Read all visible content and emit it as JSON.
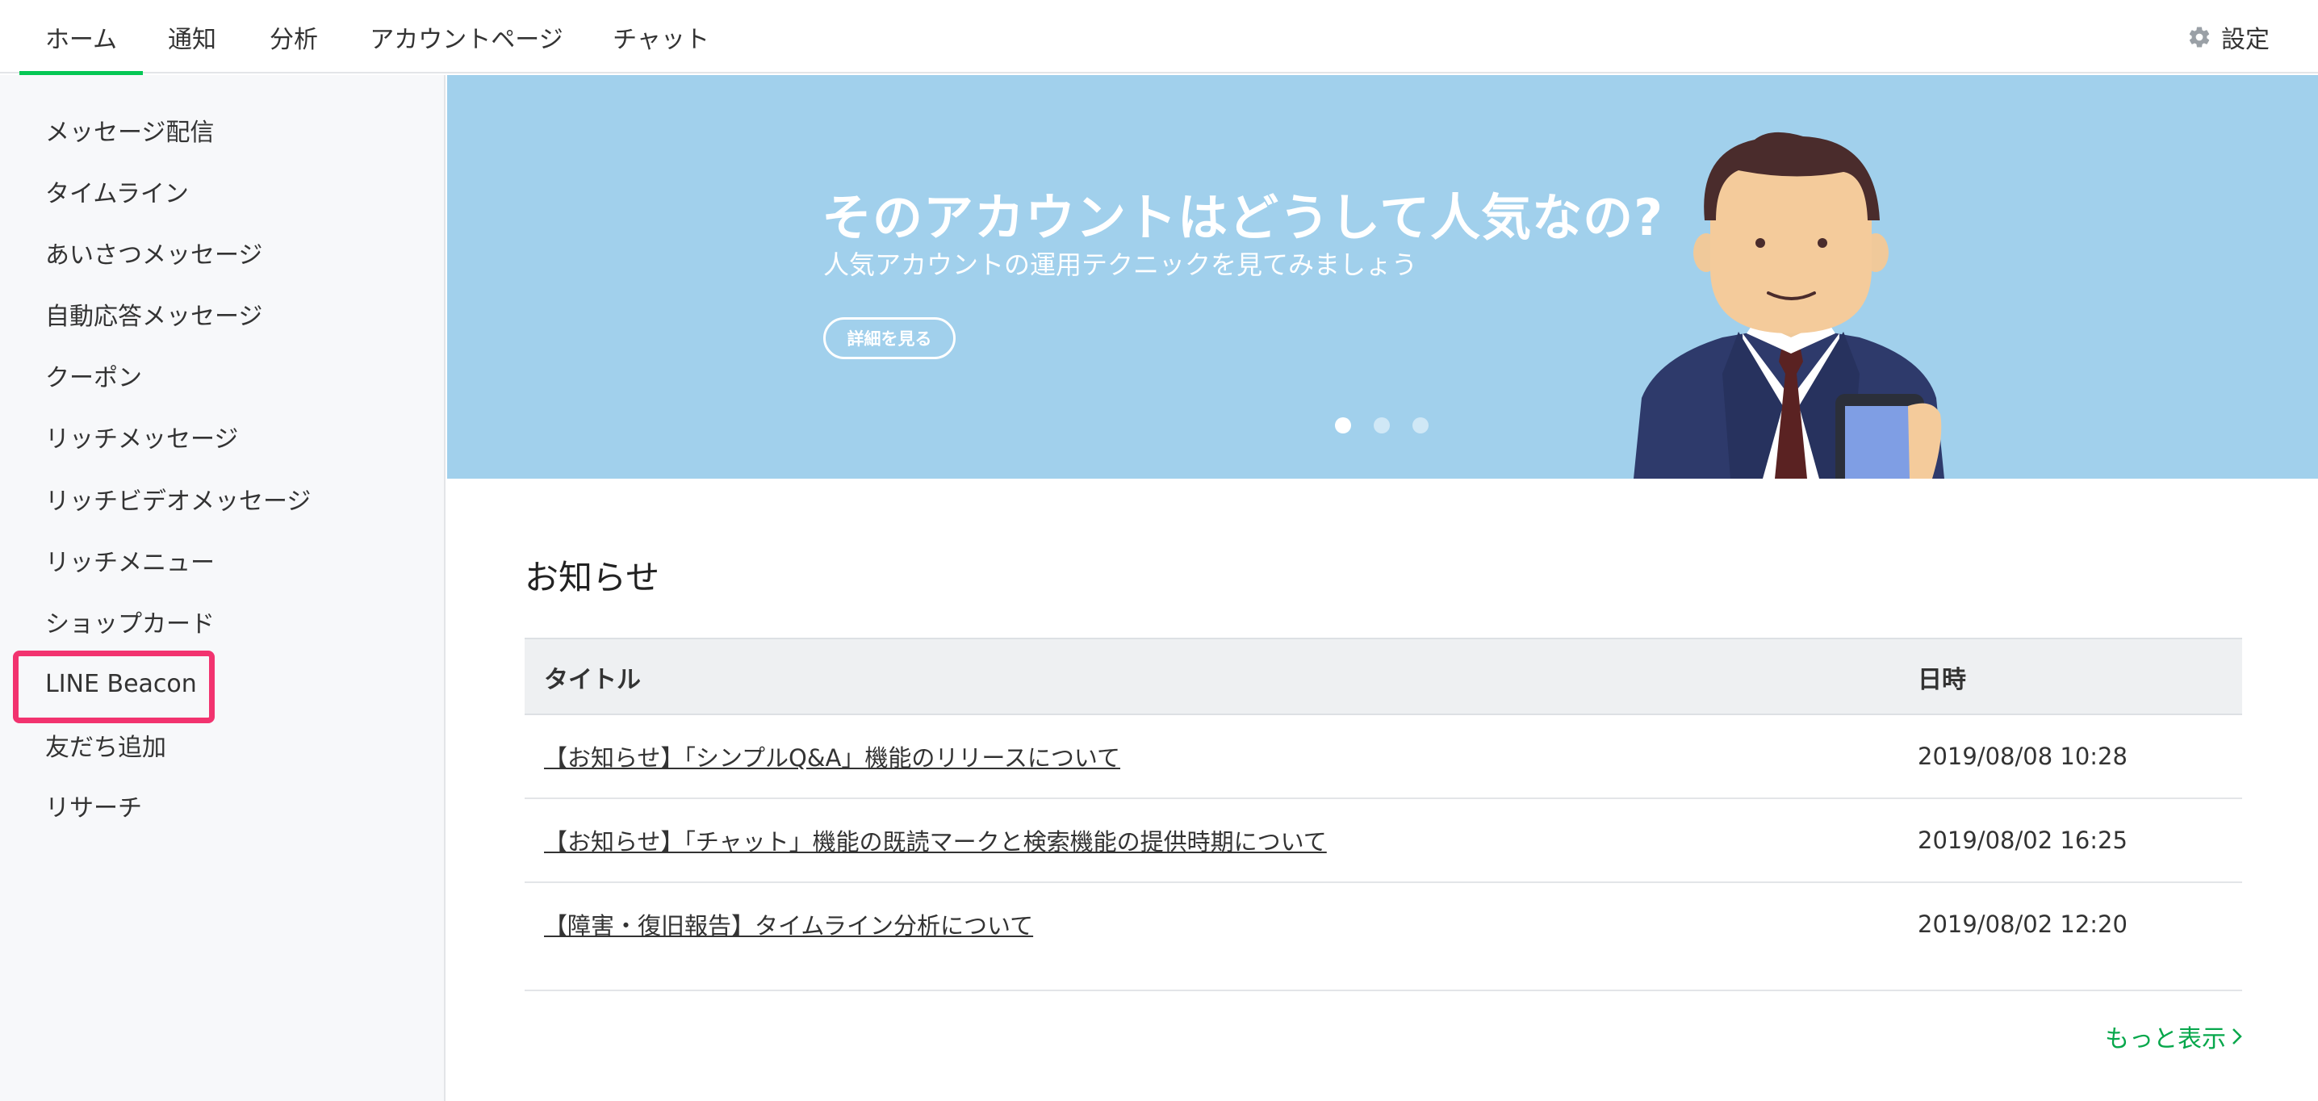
{
  "nav": {
    "tabs": [
      {
        "label": "ホーム",
        "active": true
      },
      {
        "label": "通知"
      },
      {
        "label": "分析"
      },
      {
        "label": "アカウントページ"
      },
      {
        "label": "チャット"
      }
    ],
    "settings_label": "設定",
    "settings_icon": "gear-icon"
  },
  "sidebar": {
    "items": [
      {
        "label": "メッセージ配信"
      },
      {
        "label": "タイムライン"
      },
      {
        "label": "あいさつメッセージ"
      },
      {
        "label": "自動応答メッセージ"
      },
      {
        "label": "クーポン"
      },
      {
        "label": "リッチメッセージ"
      },
      {
        "label": "リッチビデオメッセージ"
      },
      {
        "label": "リッチメニュー"
      },
      {
        "label": "ショップカード"
      },
      {
        "label": "LINE Beacon",
        "highlighted": true
      },
      {
        "label": "友だち追加"
      },
      {
        "label": "リサーチ"
      }
    ]
  },
  "banner": {
    "title": "そのアカウントはどうして人気なの?",
    "subtitle": "人気アカウントの運用テクニックを見てみましょう",
    "button_label": "詳細を見る",
    "slide_count": 3,
    "active_slide": 1
  },
  "notices": {
    "heading": "お知らせ",
    "columns": [
      "タイトル",
      "日時"
    ],
    "rows": [
      {
        "title": "【お知らせ】「シンプルQ&A」機能のリリースについて",
        "date": "2019/08/08 10:28"
      },
      {
        "title": "【お知らせ】「チャット」機能の既読マークと検索機能の提供時期について",
        "date": "2019/08/02 16:25"
      },
      {
        "title": "【障害・復旧報告】タイムライン分析について",
        "date": "2019/08/02 12:20"
      }
    ],
    "more_label": "もっと表示"
  },
  "colors": {
    "accent_green": "#06c755",
    "link_green": "#06a74b",
    "banner_bg": "#a1d0ec",
    "highlight_pink": "#f2336f"
  }
}
